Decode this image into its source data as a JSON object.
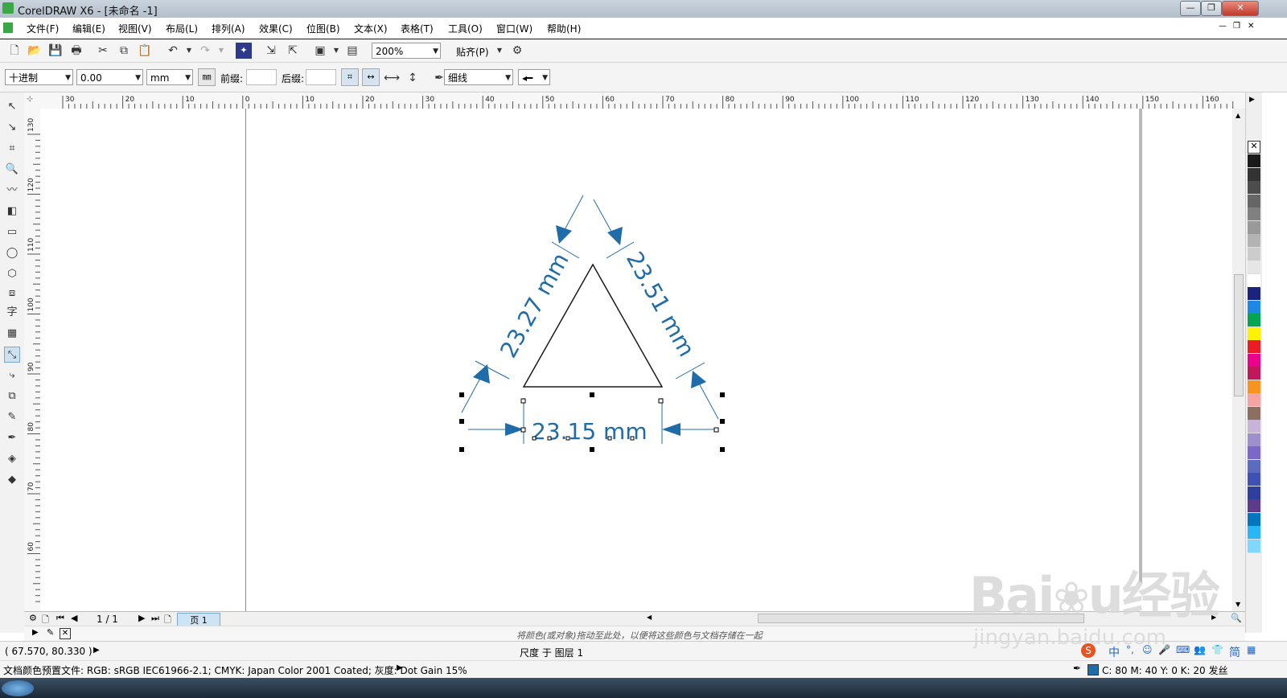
{
  "window": {
    "title": "CorelDRAW X6 - [未命名 -1]",
    "controls": {
      "minimize": "—",
      "restore": "❐",
      "close": "✕"
    }
  },
  "menu": [
    "文件(F)",
    "编辑(E)",
    "视图(V)",
    "布局(L)",
    "排列(A)",
    "效果(C)",
    "位图(B)",
    "文本(X)",
    "表格(T)",
    "工具(O)",
    "窗口(W)",
    "帮助(H)"
  ],
  "standard_toolbar": {
    "zoom": "200%",
    "snap": "贴齐(P)"
  },
  "property_bar": {
    "style": "十进制",
    "precision": "0.00",
    "units": "mm",
    "prefix_label": "前缀:",
    "suffix_label": "后缀:",
    "outline_width": "细线"
  },
  "rulers": {
    "horizontal_ticks": [
      "30",
      "20",
      "10",
      "0",
      "10",
      "20",
      "30",
      "40",
      "50",
      "60",
      "70",
      "80",
      "90",
      "100",
      "110",
      "120",
      "130",
      "140",
      "150",
      "160"
    ],
    "vertical_ticks": [
      "130",
      "120",
      "110",
      "100",
      "90",
      "80",
      "70",
      "60"
    ],
    "unit": "毫米"
  },
  "drawing": {
    "dimension_left": "23.27 mm",
    "dimension_right": "23.51 mm",
    "dimension_bottom": "23.15 mm",
    "dimension_color": "#1f6ca8"
  },
  "page_nav": {
    "counter": "1 / 1",
    "page_tab": "页 1"
  },
  "color_hint": "将颜色(或对象)拖动至此处，以便将这些颜色与文档存储在一起",
  "status": {
    "coords": "( 67.570, 80.330 )",
    "layer_info": "尺度 于 图层 1",
    "color_profile": "文档颜色预置文件: RGB: sRGB IEC61966-2.1; CMYK: Japan Color 2001 Coated; 灰度: Dot Gain 15%",
    "fill_info": "C: 80 M: 40 Y: 0 K: 20  发丝"
  },
  "ime": {
    "lang": "中",
    "mode": "简"
  },
  "watermark": {
    "brand": "Baidu经验",
    "url": "jingyan.baidu.com"
  },
  "palette_colors": [
    "#1a1a1a",
    "#333333",
    "#4d4d4d",
    "#666666",
    "#808080",
    "#999999",
    "#b3b3b3",
    "#cccccc",
    "#e6e6e6",
    "#ffffff",
    "#1a237e",
    "#1e88e5",
    "#00a651",
    "#fff200",
    "#ed1c24",
    "#ec008c",
    "#c2185b",
    "#f7941d",
    "#f5a3a3",
    "#8c6e63",
    "#c8b4d8",
    "#9e8fcf",
    "#7b68c8",
    "#5c6bc0",
    "#3f51b5",
    "#303f9f",
    "#5e3a8a",
    "#0277bd",
    "#29b6f6",
    "#80d8ff"
  ]
}
